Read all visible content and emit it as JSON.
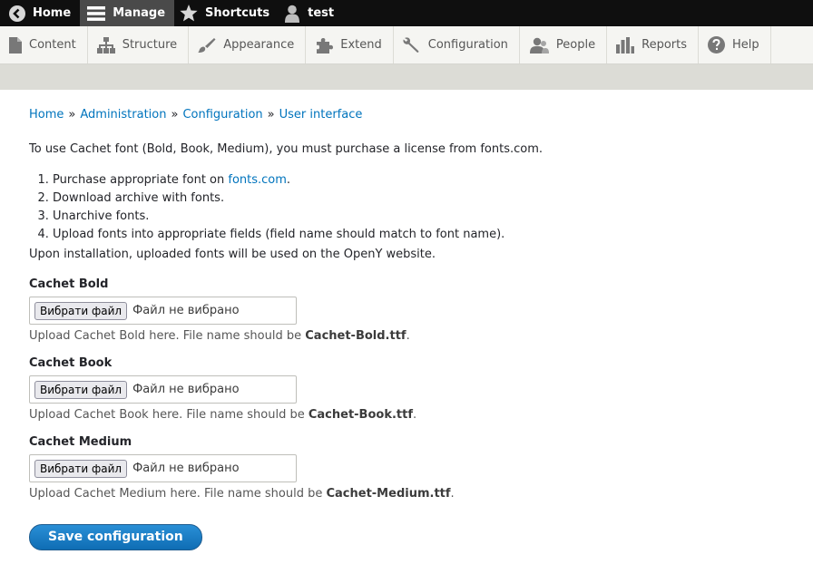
{
  "toolbar": {
    "home_label": "Home",
    "manage_label": "Manage",
    "shortcuts_label": "Shortcuts",
    "user_label": "test"
  },
  "tray": {
    "items": [
      {
        "label": "Content",
        "icon": "file-icon"
      },
      {
        "label": "Structure",
        "icon": "sitemap-icon"
      },
      {
        "label": "Appearance",
        "icon": "paintbrush-icon"
      },
      {
        "label": "Extend",
        "icon": "puzzle-icon"
      },
      {
        "label": "Configuration",
        "icon": "wrench-icon"
      },
      {
        "label": "People",
        "icon": "people-icon"
      },
      {
        "label": "Reports",
        "icon": "bar-chart-icon"
      },
      {
        "label": "Help",
        "icon": "help-icon"
      }
    ]
  },
  "breadcrumb": {
    "items": [
      "Home",
      "Administration",
      "Configuration",
      "User interface"
    ],
    "separator": "»"
  },
  "intro": "To use Cachet font (Bold, Book, Medium), you must purchase a license from fonts.com.",
  "steps": {
    "step1_prefix": "Purchase appropriate font on ",
    "step1_link": "fonts.com",
    "step1_suffix": ".",
    "step2": "Download archive with fonts.",
    "step3": "Unarchive fonts.",
    "step4": "Upload fonts into appropriate fields (field name should match to font name)."
  },
  "after_text": "Upon installation, uploaded fonts will be used on the OpenY website.",
  "fields": [
    {
      "label": "Cachet Bold",
      "button": "Вибрати файл",
      "status": "Файл не вибрано",
      "desc_prefix": "Upload Cachet Bold here. File name should be ",
      "filename": "Cachet-Bold.ttf",
      "desc_suffix": "."
    },
    {
      "label": "Cachet Book",
      "button": "Вибрати файл",
      "status": "Файл не вибрано",
      "desc_prefix": "Upload Cachet Book here. File name should be ",
      "filename": "Cachet-Book.ttf",
      "desc_suffix": "."
    },
    {
      "label": "Cachet Medium",
      "button": "Вибрати файл",
      "status": "Файл не вибрано",
      "desc_prefix": "Upload Cachet Medium here. File name should be ",
      "filename": "Cachet-Medium.ttf",
      "desc_suffix": "."
    }
  ],
  "save_label": "Save configuration",
  "colors": {
    "link": "#0074bd",
    "toolbar_bg": "#0f0f0f",
    "button_primary": "#1b7bc3"
  }
}
